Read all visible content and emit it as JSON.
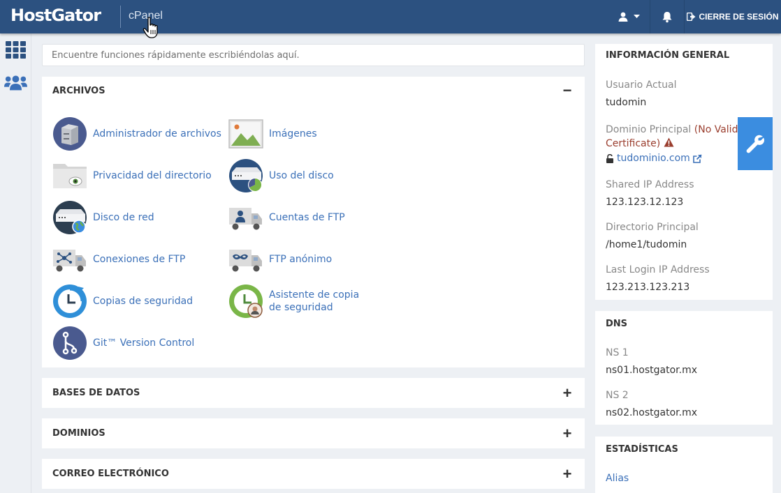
{
  "topbar": {
    "brand": "HostGator",
    "product": "cPanel",
    "logout_label": "CIERRE DE SESIÓN",
    "color": "#2c5180"
  },
  "rail": {
    "items": [
      {
        "icon": "grid-icon"
      },
      {
        "icon": "users-icon"
      }
    ]
  },
  "search": {
    "placeholder": "Encuentre funciones rápidamente escribiéndolas aquí."
  },
  "files": {
    "title": "ARCHIVOS",
    "toggle": "−",
    "tools": [
      {
        "label": "Administrador de archivos",
        "icon": "file-manager-icon"
      },
      {
        "label": "Imágenes",
        "icon": "images-icon"
      },
      {
        "label": "Privacidad del directorio",
        "icon": "directory-privacy-icon"
      },
      {
        "label": "Uso del disco",
        "icon": "disk-usage-icon"
      },
      {
        "label": "Disco de red",
        "icon": "web-disk-icon"
      },
      {
        "label": "Cuentas de FTP",
        "icon": "ftp-accounts-icon"
      },
      {
        "label": "Conexiones de FTP",
        "icon": "ftp-connections-icon"
      },
      {
        "label": "FTP anónimo",
        "icon": "anonymous-ftp-icon"
      },
      {
        "label": "Copias de seguridad",
        "icon": "backup-icon"
      },
      {
        "label": "Asistente de copia de seguridad",
        "icon": "backup-wizard-icon"
      },
      {
        "label": "Git™ Version Control",
        "icon": "git-icon"
      }
    ]
  },
  "collapsed_sections": [
    {
      "title": "BASES DE DATOS",
      "toggle": "+"
    },
    {
      "title": "DOMINIOS",
      "toggle": "+"
    },
    {
      "title": "CORREO ELECTRÓNICO",
      "toggle": "+"
    }
  ],
  "general_info": {
    "title": "INFORMACIÓN GENERAL",
    "current_user_label": "Usuario Actual",
    "current_user": "tudomin",
    "primary_domain_label": "Dominio Principal",
    "certificate_warning": "(No Valid Certificate)",
    "domain": "tudominio.com",
    "shared_ip_label": "Shared IP Address",
    "shared_ip": "123.123.12.123",
    "home_dir_label": "Directorio Principal",
    "home_dir": "/home1/tudomin",
    "last_login_label": "Last Login IP Address",
    "last_login": "123.213.123.213"
  },
  "dns": {
    "title": "DNS",
    "ns1_label": "NS 1",
    "ns1": "ns01.hostgator.mx",
    "ns2_label": "NS 2",
    "ns2": "ns02.hostgator.mx"
  },
  "stats": {
    "title": "ESTADÍSTICAS",
    "alias_label": "Alias"
  },
  "colors": {
    "link": "#3b70b8",
    "warning": "#9a3d2d",
    "accent": "#3b8de0"
  }
}
